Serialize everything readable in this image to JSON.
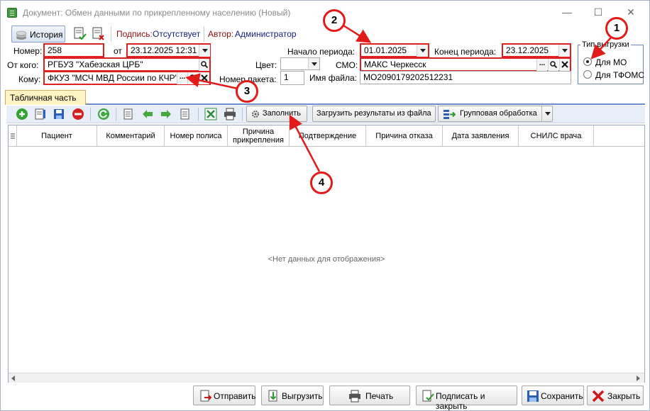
{
  "window": {
    "title": "Документ: Обмен данными по прикрепленному населению (Новый)",
    "controls": {
      "minimize": "—",
      "maximize": "☐",
      "close": "✕"
    }
  },
  "toolbar": {
    "history_label": "История",
    "signature_label": "Подпись:",
    "signature_value": "Отсутствует",
    "author_label": "Автор:",
    "author_value": "Администратор"
  },
  "form": {
    "number_label": "Номер:",
    "number_value": "258",
    "date_from_label": "от",
    "date_value": "23.12.2025 12:31",
    "from_label": "От кого:",
    "from_value": "РГБУЗ \"Хабезская ЦРБ\"",
    "to_label": "Кому:",
    "to_value": "ФКУЗ \"МСЧ МВД России по КЧР\"",
    "color_label": "Цвет:",
    "packet_label": "Номер пакета:",
    "packet_value": "1",
    "period_start_label": "Начало периода:",
    "period_start_value": "01.01.2025",
    "period_end_label": "Конец периода:",
    "period_end_value": "23.12.2025",
    "smo_label": "СМО:",
    "smo_value": "МАКС Черкесск",
    "filename_label": "Имя файла:",
    "filename_value": "MO2090179202512231",
    "ellipsis": "..."
  },
  "export_type": {
    "title": "Тип выгрузки",
    "options": [
      {
        "label": "Для МО",
        "selected": true
      },
      {
        "label": "Для ТФОМС",
        "selected": false
      }
    ]
  },
  "tab": {
    "label": "Табличная часть"
  },
  "table_toolbar": {
    "fill_label": "Заполнить",
    "load_results_label": "Загрузить результаты из файла",
    "group_processing_label": "Групповая обработка"
  },
  "grid": {
    "columns": [
      "Пациент",
      "Комментарий",
      "Номер полиса",
      "Причина прикрепления",
      "Подтверждение",
      "Причина отказа",
      "Дата заявления",
      "СНИЛС врача"
    ],
    "empty_text": "<Нет данных для отображения>"
  },
  "bottom_buttons": {
    "send": "Отправить",
    "upload": "Выгрузить",
    "print": "Печать",
    "sign_close": "Подписать и закрыть",
    "save": "Сохранить",
    "close": "Закрыть"
  },
  "callouts": [
    "1",
    "2",
    "3",
    "4"
  ],
  "colors": {
    "highlight": "#e02020",
    "tab_bg": "#fff3c4",
    "toolbar_bg": "#e8eef7"
  }
}
